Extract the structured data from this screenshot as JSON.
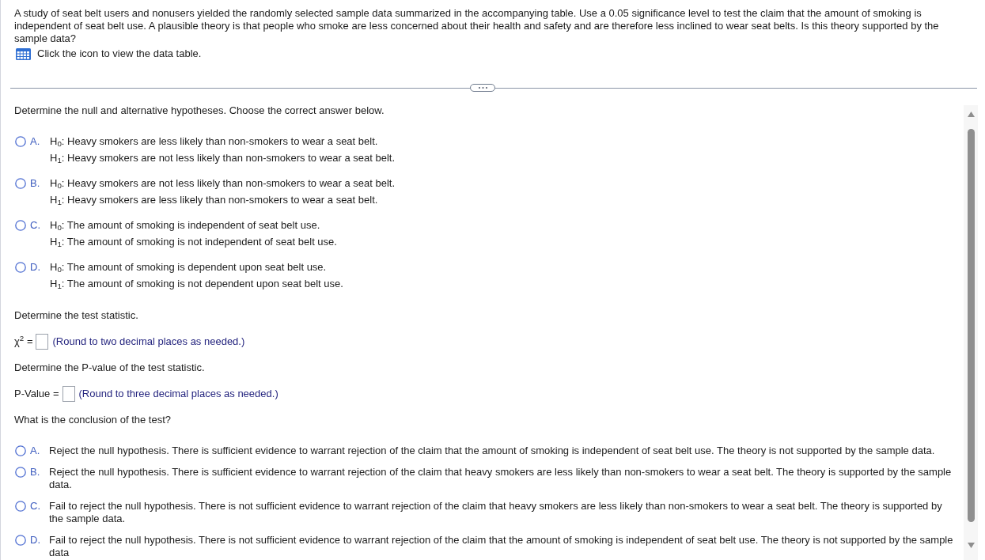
{
  "question": {
    "text": "A study of seat belt users and nonusers yielded the randomly selected sample data summarized in the accompanying table. Use a 0.05 significance level to test the claim that the amount of smoking is independent of seat belt use. A plausible theory is that people who smoke are less concerned about their health and safety and are therefore less inclined to wear seat belts. Is this theory supported by the sample data?",
    "table_hint": "Click the icon to view the data table."
  },
  "sections": [
    {
      "kind": "hypotheses",
      "prompt": "Determine the null and alternative hypotheses. Choose the correct answer below.",
      "options": [
        {
          "letter": "A.",
          "selected": false,
          "lines": [
            "H$_{0}$: Heavy smokers are less likely than non-smokers to wear a seat belt.",
            "H$_{1}$: Heavy smokers are not less likely than non-smokers to wear a seat belt."
          ]
        },
        {
          "letter": "B.",
          "selected": false,
          "lines": [
            "H$_{0}$: Heavy smokers are not less likely than non-smokers to wear a seat belt.",
            "H$_{1}$: Heavy smokers are less likely than non-smokers to wear a seat belt."
          ]
        },
        {
          "letter": "C.",
          "selected": false,
          "lines": [
            "H$_{0}$: The amount of smoking is independent of seat belt use.",
            "H$_{1}$: The amount of smoking is not independent of seat belt use."
          ]
        },
        {
          "letter": "D.",
          "selected": false,
          "lines": [
            "H$_{0}$: The amount of smoking is dependent upon seat belt use.",
            "H$_{1}$: The amount of smoking is not dependent upon seat belt use."
          ]
        }
      ]
    },
    {
      "kind": "answer",
      "prompt": "Determine the test statistic.",
      "label": "χ$^{2}$ =",
      "hint": "(Round to two decimal places as needed.)"
    },
    {
      "kind": "answer",
      "prompt": "Determine the P-value of the test statistic.",
      "label": "P-Value =",
      "hint": "(Round to three decimal places as needed.)"
    },
    {
      "kind": "choice",
      "prompt": "What is the conclusion of the test?",
      "options": [
        {
          "letter": "A.",
          "selected": false,
          "text": "Reject the null hypothesis. There is sufficient evidence to warrant rejection of the claim that the amount of smoking is independent of seat belt use. The theory is not supported by the sample data."
        },
        {
          "letter": "B.",
          "selected": false,
          "text": "Reject the null hypothesis. There is sufficient evidence to warrant rejection of the claim that heavy smokers are less likely than non-smokers to wear a seat belt. The theory is supported by the sample data."
        },
        {
          "letter": "C.",
          "selected": false,
          "text": "Fail to reject the null hypothesis. There is not sufficient evidence to warrant rejection of the claim that heavy smokers are less likely than non-smokers to wear a seat belt. The theory is supported by the sample data."
        },
        {
          "letter": "D.",
          "selected": false,
          "text": "Fail to reject the null hypothesis. There is not sufficient evidence to warrant rejection of the claim that the amount of smoking is independent of seat belt use. The theory is not supported by the sample data"
        }
      ]
    }
  ]
}
